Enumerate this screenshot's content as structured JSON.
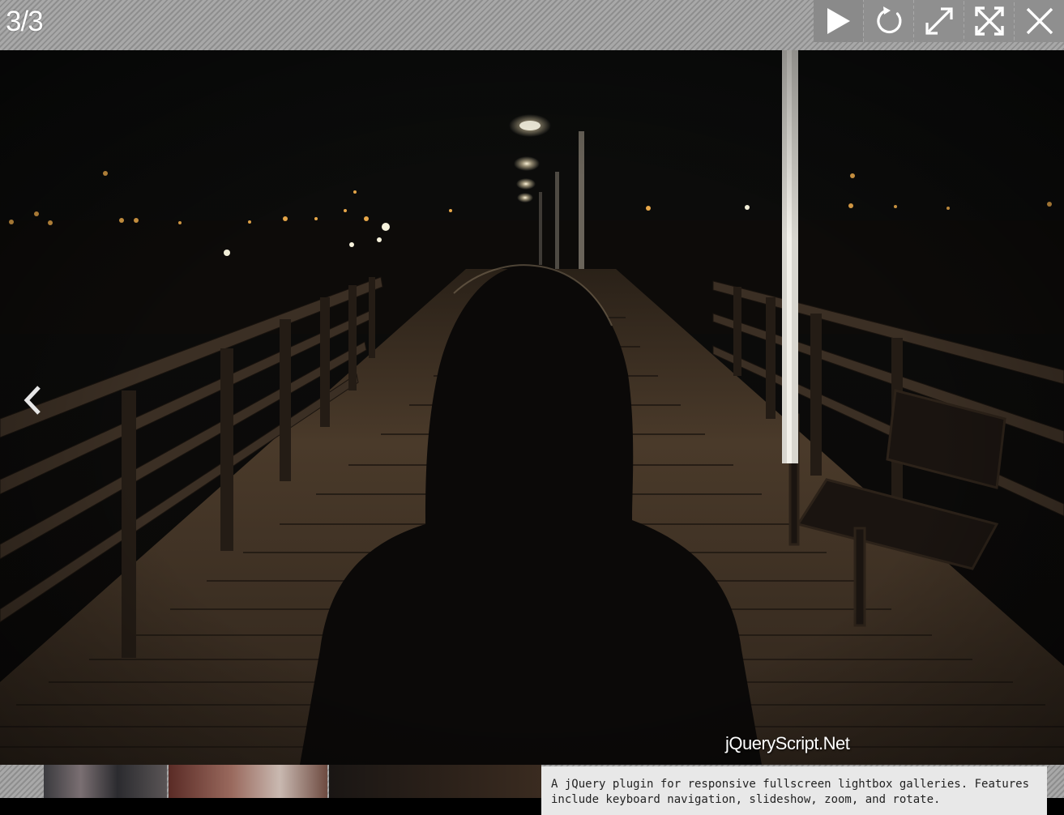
{
  "toolbar": {
    "counter": "3/3",
    "buttons": [
      {
        "name": "play",
        "icon": "play-icon"
      },
      {
        "name": "rotate",
        "icon": "rotate-icon"
      },
      {
        "name": "zoom",
        "icon": "expand-diagonal-icon"
      },
      {
        "name": "fullscreen",
        "icon": "fullscreen-icon"
      },
      {
        "name": "close",
        "icon": "close-icon"
      }
    ]
  },
  "slide": {
    "watermark": "jQueryScript.Net",
    "prev_icon": "chevron-left-icon"
  },
  "caption": {
    "text": "A jQuery plugin for responsive fullscreen lightbox galleries. Features include keyboard navigation, slideshow, zoom, and rotate."
  },
  "colors": {
    "toolbar": "#9a9a9a",
    "tool_button": "#8f8f8f",
    "icon": "#ffffff",
    "caption_bg": "#e8e8e8"
  }
}
